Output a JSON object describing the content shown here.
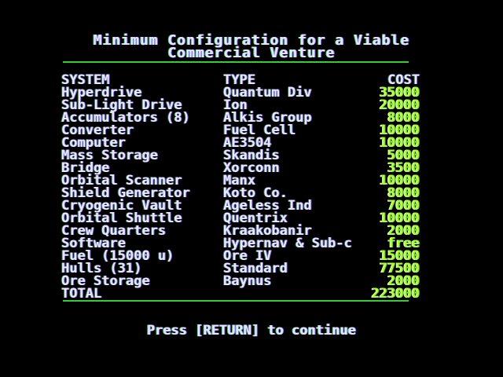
{
  "title": {
    "line1": "Minimum Configuration for a Viable",
    "line2": "Commercial Venture"
  },
  "table": {
    "headers": {
      "system": "SYSTEM",
      "type": "TYPE",
      "cost": "COST"
    },
    "rows": [
      {
        "system": "Hyperdrive",
        "type": "Quantum Div",
        "cost": "35000"
      },
      {
        "system": "Sub-Light Drive",
        "type": "Ion",
        "cost": "20000"
      },
      {
        "system": "Accumulators (8)",
        "type": "Alkis Group",
        "cost": "8000"
      },
      {
        "system": "Converter",
        "type": "Fuel Cell",
        "cost": "10000"
      },
      {
        "system": "Computer",
        "type": "AE3504",
        "cost": "10000"
      },
      {
        "system": "Mass Storage",
        "type": "Skandis",
        "cost": "5000"
      },
      {
        "system": "Bridge",
        "type": "Xorconn",
        "cost": "3500"
      },
      {
        "system": "Orbital Scanner",
        "type": "Manx",
        "cost": "10000"
      },
      {
        "system": "Shield Generator",
        "type": "Koto Co.",
        "cost": "8000"
      },
      {
        "system": "Cryogenic Vault",
        "type": "Ageless Ind",
        "cost": "7000"
      },
      {
        "system": "Orbital Shuttle",
        "type": "Quentrix",
        "cost": "10000"
      },
      {
        "system": "Crew Quarters",
        "type": "Kraakobanir",
        "cost": "2000"
      },
      {
        "system": "Software",
        "type": "Hypernav & Sub-c",
        "cost": "free"
      },
      {
        "system": "Fuel (15000 u)",
        "type": "Ore IV",
        "cost": "15000"
      },
      {
        "system": "Hulls (31)",
        "type": "Standard",
        "cost": "77500"
      },
      {
        "system": "Ore Storage",
        "type": "Baynus",
        "cost": "2000"
      }
    ],
    "total": {
      "label": "TOTAL",
      "cost": "223000"
    }
  },
  "prompt": "Press [RETURN] to continue",
  "colors": {
    "background": "#000000",
    "text": "#e8e8ff",
    "cost_digits": "#aaff33",
    "rule": "#33cc33"
  }
}
